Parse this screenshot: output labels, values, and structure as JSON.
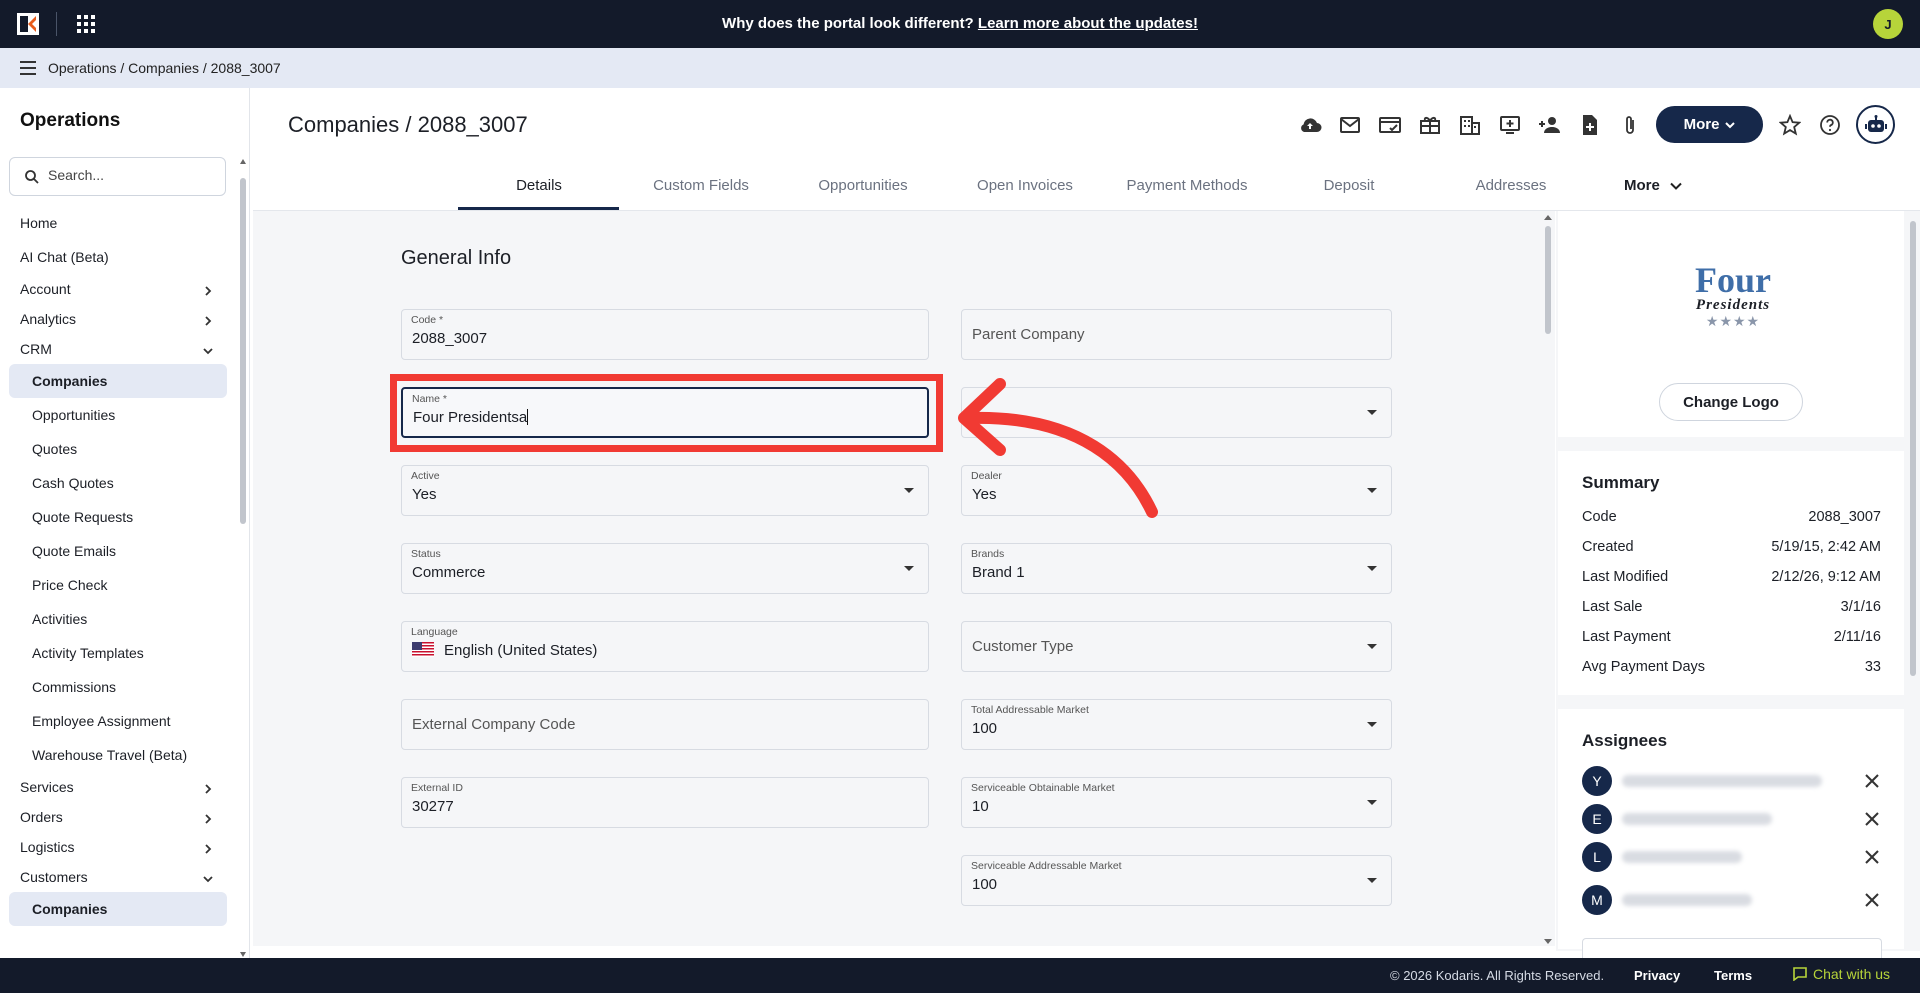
{
  "topbar": {
    "banner_text": "Why does the portal look different?",
    "banner_link": "Learn more about the updates!",
    "user_initial": "J"
  },
  "breadcrumb": "Operations / Companies / 2088_3007",
  "sidebar": {
    "title": "Operations",
    "search_placeholder": "Search...",
    "items": [
      {
        "label": "Home",
        "type": "top"
      },
      {
        "label": "AI Chat (Beta)",
        "type": "top"
      },
      {
        "label": "Account",
        "type": "top",
        "chevron": "right"
      },
      {
        "label": "Analytics",
        "type": "top",
        "chevron": "right"
      },
      {
        "label": "CRM",
        "type": "top",
        "chevron": "down"
      },
      {
        "label": "Companies",
        "type": "sub",
        "active": true
      },
      {
        "label": "Opportunities",
        "type": "sub"
      },
      {
        "label": "Quotes",
        "type": "sub"
      },
      {
        "label": "Cash Quotes",
        "type": "sub"
      },
      {
        "label": "Quote Requests",
        "type": "sub"
      },
      {
        "label": "Quote Emails",
        "type": "sub"
      },
      {
        "label": "Price Check",
        "type": "sub"
      },
      {
        "label": "Activities",
        "type": "sub"
      },
      {
        "label": "Activity Templates",
        "type": "sub"
      },
      {
        "label": "Commissions",
        "type": "sub"
      },
      {
        "label": "Employee Assignment",
        "type": "sub"
      },
      {
        "label": "Warehouse Travel (Beta)",
        "type": "sub"
      },
      {
        "label": "Services",
        "type": "top",
        "chevron": "right"
      },
      {
        "label": "Orders",
        "type": "top",
        "chevron": "right"
      },
      {
        "label": "Logistics",
        "type": "top",
        "chevron": "right"
      },
      {
        "label": "Customers",
        "type": "top",
        "chevron": "down"
      },
      {
        "label": "Companies",
        "type": "sub",
        "active": true
      }
    ]
  },
  "header": {
    "title": "Companies / 2088_3007",
    "more_label": "More",
    "toolbar_icons": [
      "cloud-upload-icon",
      "mail-icon",
      "card-check-icon",
      "gift-icon",
      "building-icon",
      "screen-add-icon",
      "person-add-icon",
      "file-add-icon",
      "attach-icon"
    ]
  },
  "tabs": [
    {
      "label": "Details",
      "active": true
    },
    {
      "label": "Custom Fields"
    },
    {
      "label": "Opportunities"
    },
    {
      "label": "Open Invoices"
    },
    {
      "label": "Payment Methods"
    },
    {
      "label": "Deposit"
    },
    {
      "label": "Addresses"
    }
  ],
  "tabs_more": "More",
  "form": {
    "section_title": "General Info",
    "code": {
      "label": "Code *",
      "value": "2088_3007"
    },
    "parent_company": {
      "placeholder": "Parent Company"
    },
    "name": {
      "label": "Name *",
      "value": "Four Presidentsa"
    },
    "active": {
      "label": "Active",
      "value": "Yes"
    },
    "dealer": {
      "label": "Dealer",
      "value": "Yes"
    },
    "status": {
      "label": "Status",
      "value": "Commerce"
    },
    "brands": {
      "label": "Brands",
      "value": "Brand 1"
    },
    "language": {
      "label": "Language",
      "value": "English (United States)"
    },
    "customer_type": {
      "placeholder": "Customer Type"
    },
    "external_company_code": {
      "placeholder": "External Company Code"
    },
    "tam": {
      "label": "Total Addressable Market",
      "value": "100"
    },
    "external_id": {
      "label": "External ID",
      "value": "30277"
    },
    "som": {
      "label": "Serviceable Obtainable Market",
      "value": "10"
    },
    "sam": {
      "label": "Serviceable Addressable Market",
      "value": "100"
    }
  },
  "right_panel": {
    "logo_word1": "Four",
    "logo_word2": "Presidents",
    "logo_stars": "★★★★",
    "change_logo": "Change Logo",
    "summary_title": "Summary",
    "summary": [
      {
        "key": "Code",
        "value": "2088_3007"
      },
      {
        "key": "Created",
        "value": "5/19/15, 2:42 AM"
      },
      {
        "key": "Last Modified",
        "value": "2/12/26, 9:12 AM"
      },
      {
        "key": "Last Sale",
        "value": "3/1/16"
      },
      {
        "key": "Last Payment",
        "value": "2/11/16"
      },
      {
        "key": "Avg Payment Days",
        "value": "33"
      }
    ],
    "assignees_title": "Assignees",
    "assignees": [
      "Y",
      "E",
      "L",
      "M"
    ]
  },
  "footer": {
    "copyright": "© 2026 Kodaris. All Rights Reserved.",
    "privacy": "Privacy",
    "terms": "Terms",
    "chat": "Chat with us"
  },
  "colors": {
    "navy": "#16284a",
    "topbar": "#131a2a",
    "accent_green": "#b7d43a",
    "annotation_red": "#f13a33"
  }
}
